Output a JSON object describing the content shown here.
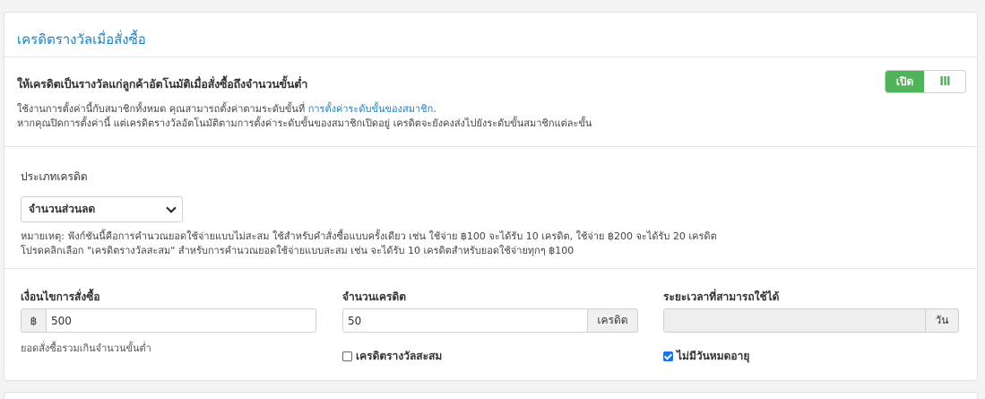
{
  "panel": {
    "title": "เครดิตรางวัลเมื่อสั่งซื้อ"
  },
  "settings": {
    "heading": "ให้เครดิตเป็นรางวัลแก่ลูกค้าอัตโนมัติเมื่อสั่งซื้อถึงจำนวนขั้นต่ำ",
    "desc_prefix": "ใช้งานการตั้งค่านี้กับสมาชิกทั้งหมด คุณสามารถตั้งค่าตามระดับขั้นที่ ",
    "desc_link": "การตั้งค่าระดับขั้นของสมาชิก",
    "desc_suffix": ".",
    "desc_line2": "หากคุณปิดการตั้งค่านี้ แต่เครดิตรางวัลอัตโนมัติตามการตั้งค่าระดับขั้นของสมาชิกเปิดอยู่ เครดิตจะยังคงส่งไปยังระดับขั้นสมาชิกแต่ละขั้น",
    "toggle_on_label": "เปิด",
    "toggle_off_label": "III",
    "accent_color": "#4fb359"
  },
  "credit_type": {
    "label": "ประเภทเครดิต",
    "selected": "จำนวนส่วนลด",
    "note_line1": "หมายเหตุ: ฟังก์ชันนี้คือการคำนวณยอดใช้จ่ายแบบไม่สะสม ใช้สำหรับคำสั่งซื้อแบบครั้งเดียว เช่น ใช้จ่าย ฿100 จะได้รับ 10 เครดิต, ใช้จ่าย ฿200 จะได้รับ 20 เครดิต",
    "note_line2": "โปรดคลิกเลือก \"เครดิตรางวัลสะสม\" สำหรับการคำนวณยอดใช้จ่ายแบบสะสม เช่น จะได้รับ 10 เครดิตสำหรับยอดใช้จ่ายทุกๆ ฿100"
  },
  "condition": {
    "label": "เงื่อนไขการสั่งซื้อ",
    "currency": "฿",
    "value": "500",
    "help": "ยอดสั่งซื้อรวมเกินจำนวนขั้นต่ำ"
  },
  "credit_amount": {
    "label": "จำนวนเครดิต",
    "value": "50",
    "unit": "เครดิต",
    "cumulative_label": "เครดิตรางวัลสะสม",
    "cumulative_checked": false
  },
  "validity": {
    "label": "ระยะเวลาที่สามารถใช้ได้",
    "value": "",
    "unit": "วัน",
    "no_expiry_label": "ไม่มีวันหมดอายุ",
    "no_expiry_checked": true
  }
}
